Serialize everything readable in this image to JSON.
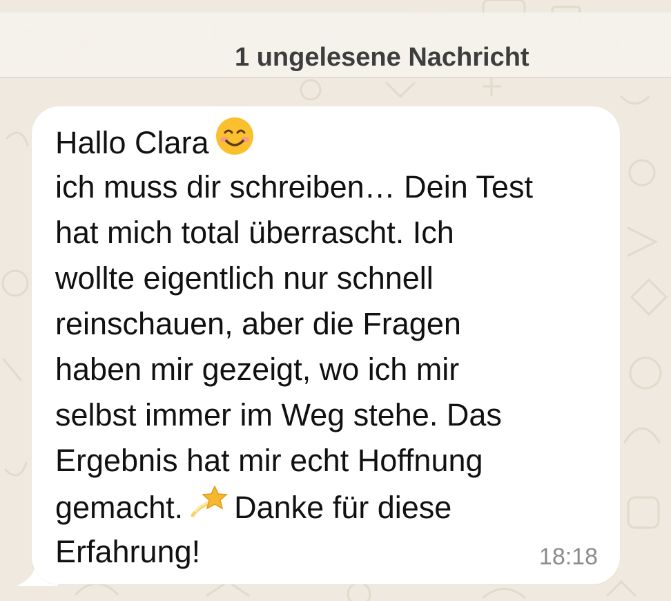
{
  "banner": {
    "text": "1 ungelesene Nachricht"
  },
  "message": {
    "lines": [
      {
        "before": "Hallo Clara",
        "emoji": "smiling-face-icon",
        "after": ""
      },
      {
        "before": "ich muss dir schreiben… Dein Test",
        "emoji": "",
        "after": ""
      },
      {
        "before": "hat mich total überrascht. Ich",
        "emoji": "",
        "after": ""
      },
      {
        "before": "wollte eigentlich nur schnell",
        "emoji": "",
        "after": ""
      },
      {
        "before": "reinschauen, aber die Fragen",
        "emoji": "",
        "after": ""
      },
      {
        "before": "haben mir gezeigt, wo ich mir",
        "emoji": "",
        "after": ""
      },
      {
        "before": "selbst immer im Weg stehe. Das",
        "emoji": "",
        "after": ""
      },
      {
        "before": "Ergebnis hat mir echt Hoffnung",
        "emoji": "",
        "after": ""
      },
      {
        "before": "gemacht.",
        "emoji": "dizzy-star-icon",
        "after": "Danke für diese"
      },
      {
        "before": "Erfahrung!",
        "emoji": "",
        "after": ""
      }
    ],
    "time": "18:18"
  },
  "colors": {
    "wallpaper": "#efe9df",
    "bubble": "#ffffff",
    "text": "#111111",
    "timestamp": "#8c8c8c",
    "emoji_face": "#fbc02d",
    "emoji_star": "#f5b82e"
  }
}
